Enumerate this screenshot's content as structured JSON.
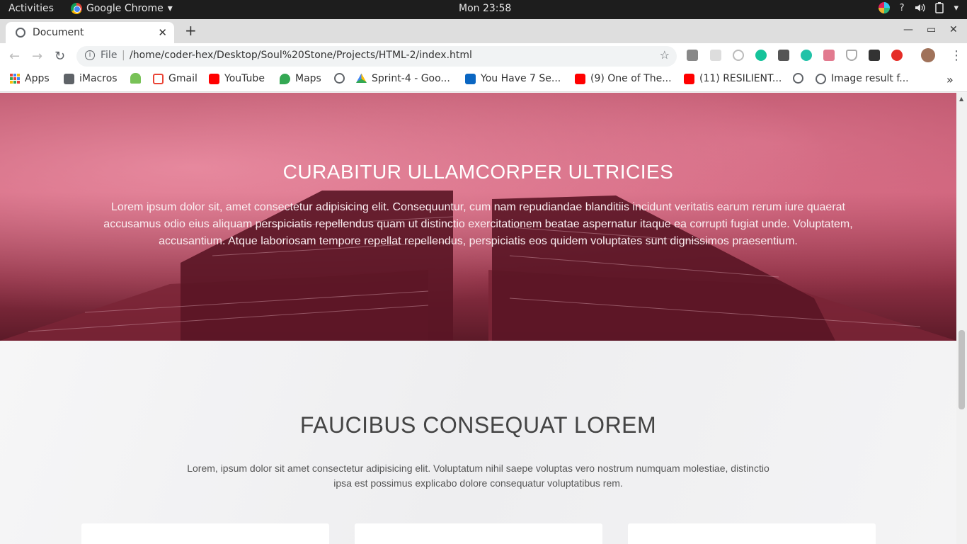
{
  "os_topbar": {
    "activities": "Activities",
    "app_name": "Google Chrome",
    "app_menu_arrow": "▾",
    "clock": "Mon 23:58",
    "tray": {
      "help": "?",
      "menu_arrow": "▾"
    }
  },
  "browser": {
    "tab": {
      "title": "Document",
      "close": "✕"
    },
    "new_tab": "+",
    "window_controls": {
      "minimize": "—",
      "maximize": "▭",
      "close": "✕"
    },
    "nav": {
      "back": "←",
      "forward": "→",
      "reload": "↻"
    },
    "omnibox": {
      "info": "i",
      "scheme_label": "File",
      "separator": "|",
      "url": "/home/coder-hex/Desktop/Soul%20Stone/Projects/HTML-2/index.html",
      "star": "☆"
    },
    "menu_dots": "⋮",
    "bookmarks": [
      {
        "label": "Apps",
        "icon": "apps-grid-icon"
      },
      {
        "label": "iMacros",
        "icon": "folder-icon"
      },
      {
        "label": "",
        "icon": "android-icon"
      },
      {
        "label": "Gmail",
        "icon": "gmail-icon"
      },
      {
        "label": "YouTube",
        "icon": "youtube-icon"
      },
      {
        "label": "Maps",
        "icon": "maps-icon"
      },
      {
        "label": "",
        "icon": "globe-icon"
      },
      {
        "label": "Sprint-4 - Goo...",
        "icon": "drive-icon"
      },
      {
        "label": "You Have 7 Se...",
        "icon": "linkedin-icon"
      },
      {
        "label": "(9) One of The...",
        "icon": "youtube-icon"
      },
      {
        "label": "(11) RESILIENT...",
        "icon": "youtube-icon"
      },
      {
        "label": "",
        "icon": "globe-icon"
      },
      {
        "label": "Image result f...",
        "icon": "globe-icon"
      }
    ],
    "bookmarks_overflow": "»"
  },
  "page": {
    "hero": {
      "title": "CURABITUR ULLAMCORPER ULTRICIES",
      "text": "Lorem ipsum dolor sit, amet consectetur adipisicing elit. Consequuntur, cum nam repudiandae blanditiis incidunt veritatis earum rerum iure quaerat accusamus odio eius aliquam perspiciatis repellendus quam ut distinctio exercitationem beatae aspernatur itaque ea corrupti fugiat unde. Voluptatem, accusantium. Atque laboriosam tempore repellat repellendus, perspiciatis eos quidem voluptates sunt dignissimos praesentium."
    },
    "section": {
      "title": "FAUCIBUS CONSEQUAT LOREM",
      "text": "Lorem, ipsum dolor sit amet consectetur adipisicing elit. Voluptatum nihil saepe voluptas vero nostrum numquam molestiae, distinctio ipsa est possimus explicabo dolore consequatur voluptatibus rem."
    },
    "scroll_up": "▲"
  },
  "colors": {
    "hero_tint": "#c75a72",
    "topbar_bg": "#1d1d1d",
    "youtube_red": "#ff0000",
    "linkedin_blue": "#0a66c2"
  }
}
